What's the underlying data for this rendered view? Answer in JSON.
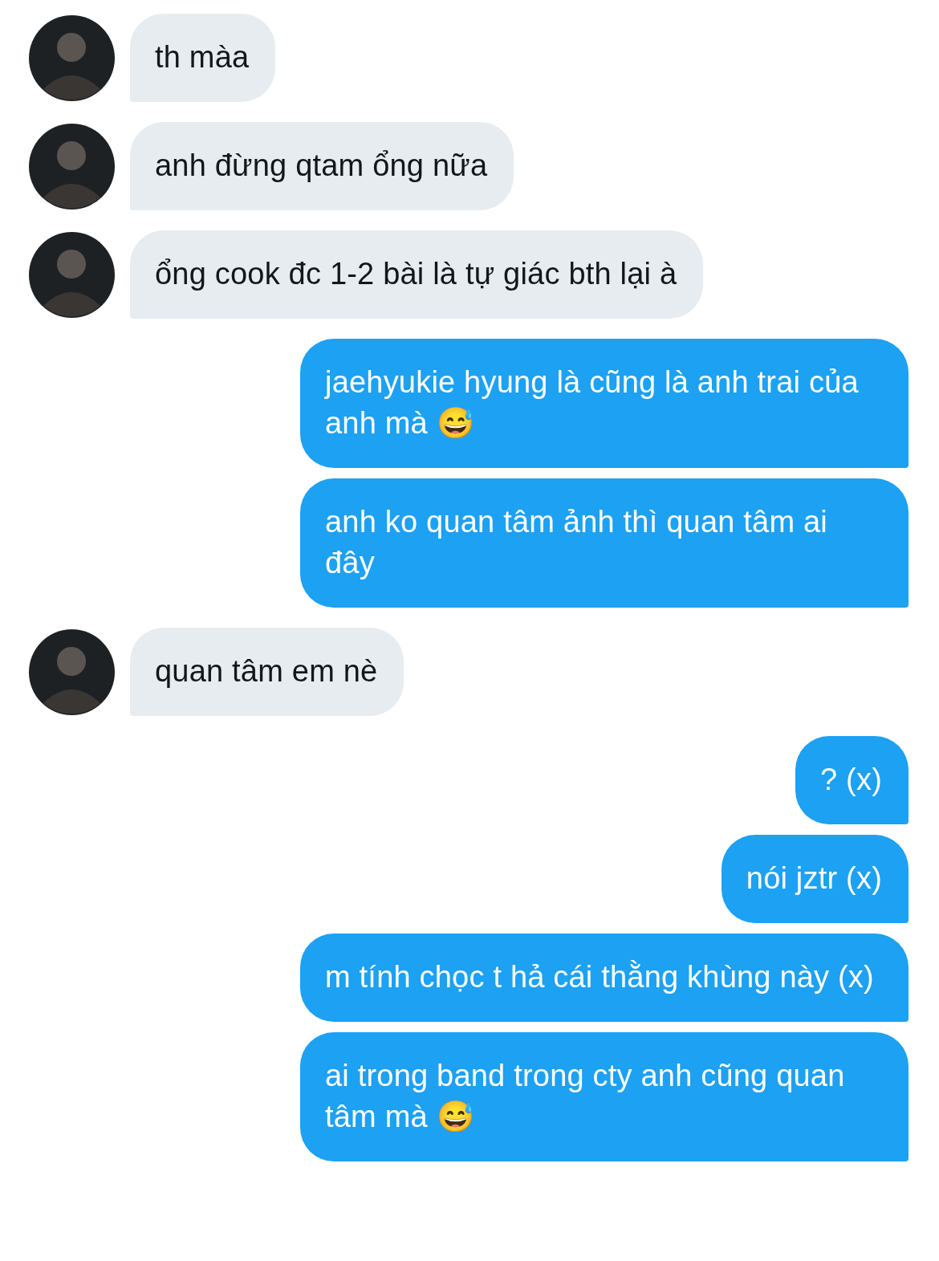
{
  "messages": [
    {
      "kind": "received",
      "text": "th màa"
    },
    {
      "kind": "received",
      "text": "anh đừng qtam ổng nữa"
    },
    {
      "kind": "received",
      "text": "ổng cook đc 1-2 bài là tự giác bth lại à"
    },
    {
      "kind": "sent",
      "text": "jaehyukie hyung là cũng là anh trai của anh mà 😅"
    },
    {
      "kind": "sent",
      "text": "anh ko quan tâm ảnh thì quan tâm ai đây"
    },
    {
      "kind": "received",
      "text": "quan tâm em nè"
    },
    {
      "kind": "sent",
      "text": "? (x)"
    },
    {
      "kind": "sent",
      "text": "nói jztr (x)"
    },
    {
      "kind": "sent",
      "text": "m tính chọc t hả cái thằng khùng này (x)"
    },
    {
      "kind": "sent",
      "text": "ai trong band trong cty anh cũng quan tâm mà 😅"
    }
  ]
}
